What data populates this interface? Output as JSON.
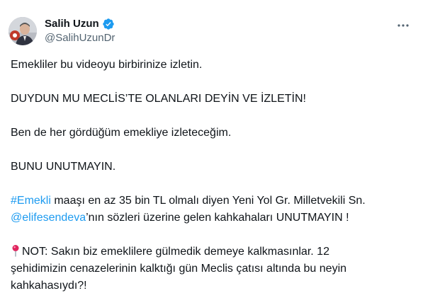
{
  "author": {
    "name": "Salih Uzun",
    "handle": "@SalihUzunDr"
  },
  "menu": {
    "more_label": "···"
  },
  "tweet": {
    "p1": "Emekliler bu videoyu birbirinize izletin.",
    "p2": "DUYDUN MU MECLİS’TE OLANLARI DEYİN VE İZLETİN!",
    "p3": "Ben de her gördüğüm emekliye izleteceğim.",
    "p4": "BUNU UNUTMAYIN.",
    "p5": {
      "hashtag": "#Emekli",
      "text_a": " maaşı en az 35 bin TL olmalı diyen Yeni Yol Gr. Milletvekili Sn.",
      "mention": "@elifesendeva",
      "text_b": "’nın sözleri üzerine gelen kahkahaları UNUTMAYIN !"
    },
    "p6": {
      "icon": "pin-icon",
      "line1": "NOT: Sakın biz emeklilere gülmedik demeye kalkmasınlar. 12",
      "line2": "şehidimizin cenazelerinin kalktığı gün Meclis çatısı altında bu neyin",
      "line3": "kahkahasıydı?!"
    }
  },
  "colors": {
    "link": "#1d9bf0",
    "text": "#0f1419",
    "secondary": "#536471",
    "verified": "#1d9bf0"
  }
}
